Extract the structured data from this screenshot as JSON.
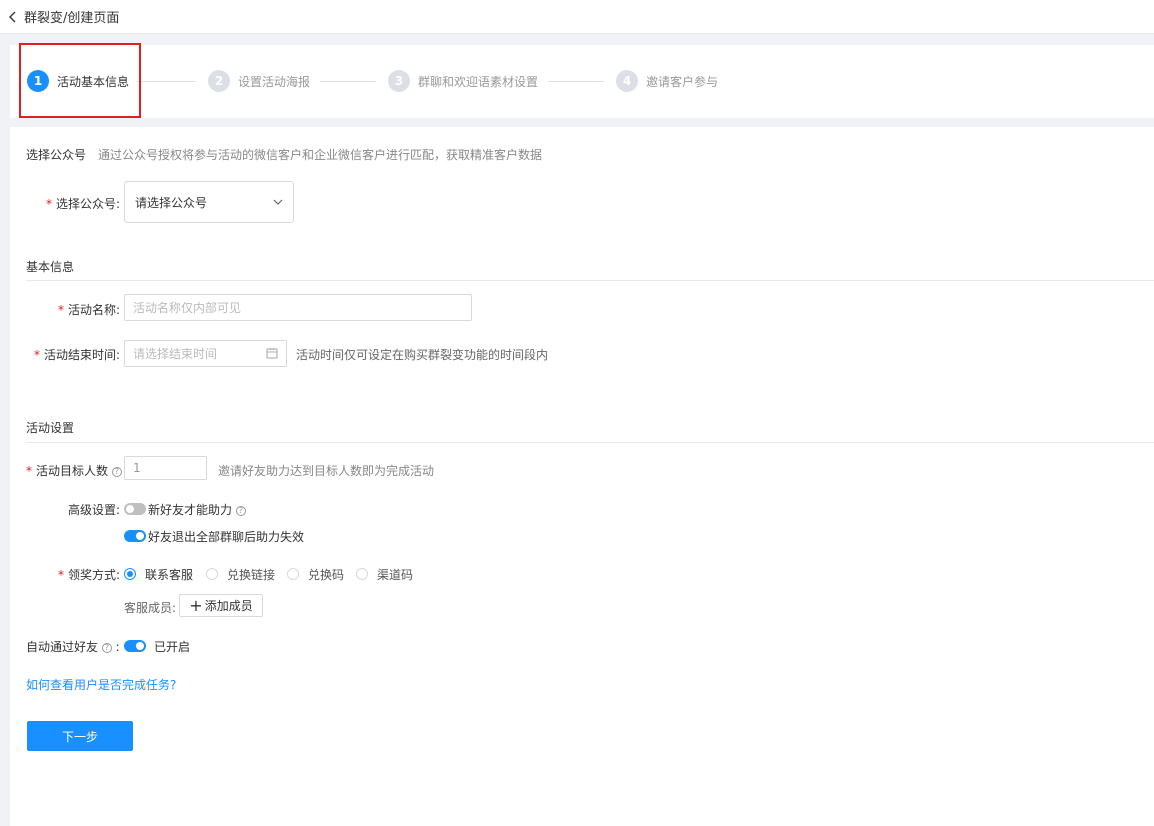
{
  "header": {
    "back_label": "群裂变/创建页面"
  },
  "steps": [
    {
      "num": "1",
      "label": "活动基本信息"
    },
    {
      "num": "2",
      "label": "设置活动海报"
    },
    {
      "num": "3",
      "label": "群聊和欢迎语素材设置"
    },
    {
      "num": "4",
      "label": "邀请客户参与"
    }
  ],
  "account_section": {
    "title": "选择公众号",
    "hint": "通过公众号授权将参与活动的微信客户和企业微信客户进行匹配，获取精准客户数据",
    "field_label": "选择公众号:",
    "select_value": "请选择公众号"
  },
  "basic_section": {
    "title": "基本信息",
    "name_label": "活动名称:",
    "name_placeholder": "活动名称仅内部可见",
    "end_label": "活动结束时间:",
    "end_placeholder": "请选择结束时间",
    "end_hint": "活动时间仅可设定在购买群裂变功能的时间段内"
  },
  "settings_section": {
    "title": "活动设置",
    "target_label": "活动目标人数",
    "target_value": "1",
    "target_hint": "邀请好友助力达到目标人数即为完成活动",
    "advanced_label": "高级设置:",
    "toggle1_label": "新好友才能助力",
    "toggle2_label": "好友退出全部群聊后助力失效",
    "reward_label": "领奖方式:",
    "reward_options": [
      "联系客服",
      "兑换链接",
      "兑换码",
      "渠道码"
    ],
    "staff_label": "客服成员:",
    "add_member_label": "添加成员",
    "auto_label": "自动通过好友",
    "auto_status": "已开启",
    "help_link": "如何查看用户是否完成任务?",
    "next_button": "下一步"
  },
  "colors": {
    "primary": "#1890ff",
    "required": "#e02020",
    "highlight": "#e02020"
  }
}
